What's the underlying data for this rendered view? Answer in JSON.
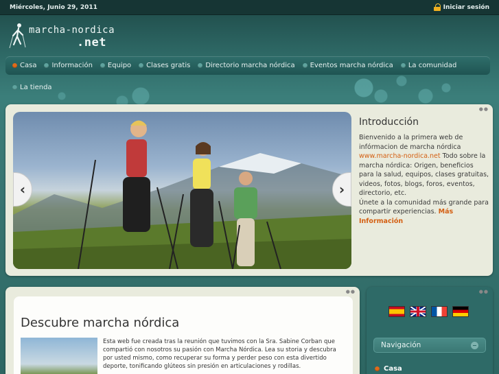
{
  "topbar": {
    "date": "Miércoles, Junio 29, 2011",
    "login": "Iniciar sesión"
  },
  "logo": {
    "line1": "marcha-nordica",
    "line2": ".net"
  },
  "nav": {
    "items": [
      "Casa",
      "Información",
      "Equipo",
      "Clases gratis",
      "Directorio marcha nórdica",
      "Eventos marcha nórdica",
      "La comunidad"
    ],
    "second_row": "La tienda"
  },
  "intro": {
    "title": "Introducción",
    "text1": "Bienvenido a la primera web de infórmacion de marcha nórdica",
    "link": "www.marcha-nordica.net",
    "text2": "Todo sobre la marcha nórdica: Origen, beneficios para la salud, equipos, clases gratuitas, videos, fotos, blogs, foros, eventos, directorio, etc.",
    "text3": "Únete a la comunidad más grande para compartir experiencias.",
    "more": "Más Información"
  },
  "main": {
    "title": "Descubre marcha nórdica",
    "body": "Esta web fue creada tras la reunión que tuvimos con la Sra. Sabine Corban que compartió con nosotros su pasión con Marcha Nórdica. Lea su storia y descubra por usted mismo, como recuperar su forma y perder peso con esta divertido deporte, tonificando glúteos sin presión en articulaciones y rodillas."
  },
  "sidebar": {
    "nav_title": "Navigación",
    "first_item": "Casa"
  },
  "colors": {
    "accent": "#d45f12",
    "teal": "#2f6a66"
  }
}
